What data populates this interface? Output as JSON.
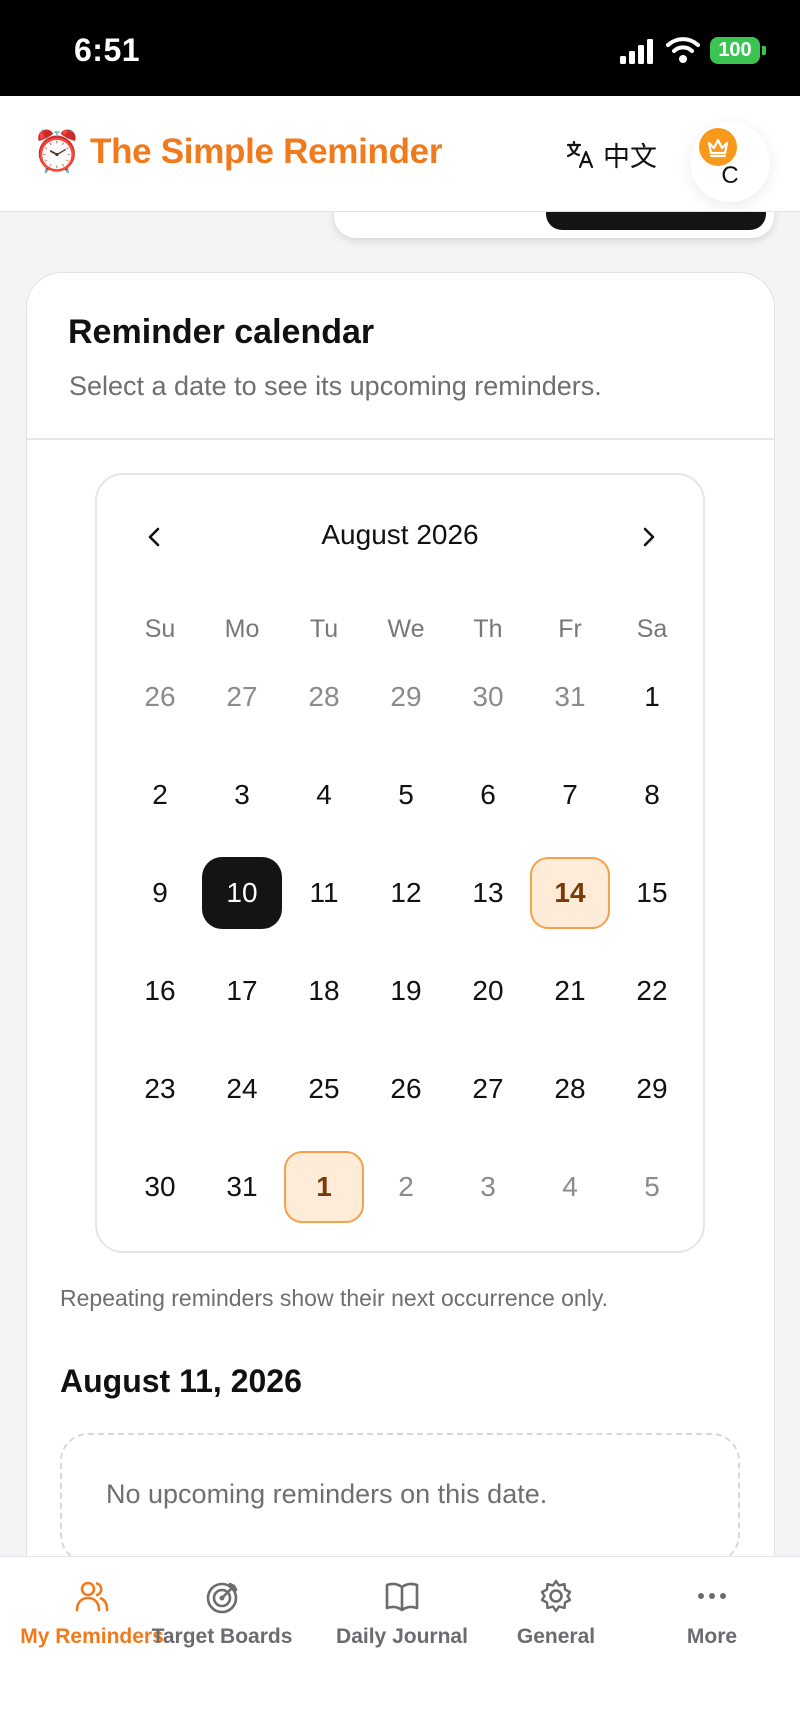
{
  "status_bar": {
    "time": "6:51",
    "battery": "100"
  },
  "header": {
    "logo_emoji": "⏰",
    "title": "The Simple Reminder",
    "language_label": "中文",
    "avatar_initial": "C"
  },
  "card": {
    "title": "Reminder calendar",
    "subtitle": "Select a date to see its upcoming reminders."
  },
  "calendar": {
    "month_label": "August 2026",
    "weekdays": [
      "Su",
      "Mo",
      "Tu",
      "We",
      "Th",
      "Fr",
      "Sa"
    ],
    "weeks": [
      [
        {
          "d": "26",
          "s": "outside"
        },
        {
          "d": "27",
          "s": "outside"
        },
        {
          "d": "28",
          "s": "outside"
        },
        {
          "d": "29",
          "s": "outside"
        },
        {
          "d": "30",
          "s": "outside"
        },
        {
          "d": "31",
          "s": "outside"
        },
        {
          "d": "1",
          "s": "normal"
        }
      ],
      [
        {
          "d": "2",
          "s": "normal"
        },
        {
          "d": "3",
          "s": "normal"
        },
        {
          "d": "4",
          "s": "normal"
        },
        {
          "d": "5",
          "s": "normal"
        },
        {
          "d": "6",
          "s": "normal"
        },
        {
          "d": "7",
          "s": "normal"
        },
        {
          "d": "8",
          "s": "normal"
        }
      ],
      [
        {
          "d": "9",
          "s": "normal"
        },
        {
          "d": "10",
          "s": "selected"
        },
        {
          "d": "11",
          "s": "normal"
        },
        {
          "d": "12",
          "s": "normal"
        },
        {
          "d": "13",
          "s": "normal"
        },
        {
          "d": "14",
          "s": "has-reminder"
        },
        {
          "d": "15",
          "s": "normal"
        }
      ],
      [
        {
          "d": "16",
          "s": "normal"
        },
        {
          "d": "17",
          "s": "normal"
        },
        {
          "d": "18",
          "s": "normal"
        },
        {
          "d": "19",
          "s": "normal"
        },
        {
          "d": "20",
          "s": "normal"
        },
        {
          "d": "21",
          "s": "normal"
        },
        {
          "d": "22",
          "s": "normal"
        }
      ],
      [
        {
          "d": "23",
          "s": "normal"
        },
        {
          "d": "24",
          "s": "normal"
        },
        {
          "d": "25",
          "s": "normal"
        },
        {
          "d": "26",
          "s": "normal"
        },
        {
          "d": "27",
          "s": "normal"
        },
        {
          "d": "28",
          "s": "normal"
        },
        {
          "d": "29",
          "s": "normal"
        }
      ],
      [
        {
          "d": "30",
          "s": "normal"
        },
        {
          "d": "31",
          "s": "normal"
        },
        {
          "d": "1",
          "s": "has-reminder"
        },
        {
          "d": "2",
          "s": "outside"
        },
        {
          "d": "3",
          "s": "outside"
        },
        {
          "d": "4",
          "s": "outside"
        },
        {
          "d": "5",
          "s": "outside"
        }
      ]
    ]
  },
  "note": "Repeating reminders show their next occurrence only.",
  "selected_date_heading": "August 11, 2026",
  "empty_state": "No upcoming reminders on this date.",
  "bottom_nav": {
    "items": [
      {
        "label": "My Reminders",
        "icon": "users-icon",
        "active": true
      },
      {
        "label": "Target Boards",
        "icon": "target-icon",
        "active": false
      },
      {
        "label": "Daily Journal",
        "icon": "book-icon",
        "active": false
      },
      {
        "label": "General",
        "icon": "gear-icon",
        "active": false
      },
      {
        "label": "More",
        "icon": "more-dots-icon",
        "active": false
      }
    ]
  },
  "colors": {
    "brand_orange": "#f07a1c",
    "selected_day": "#141414",
    "reminder_day_fill": "#ffecd8",
    "reminder_day_border": "#f5a04a",
    "battery_green": "#3bc452"
  }
}
